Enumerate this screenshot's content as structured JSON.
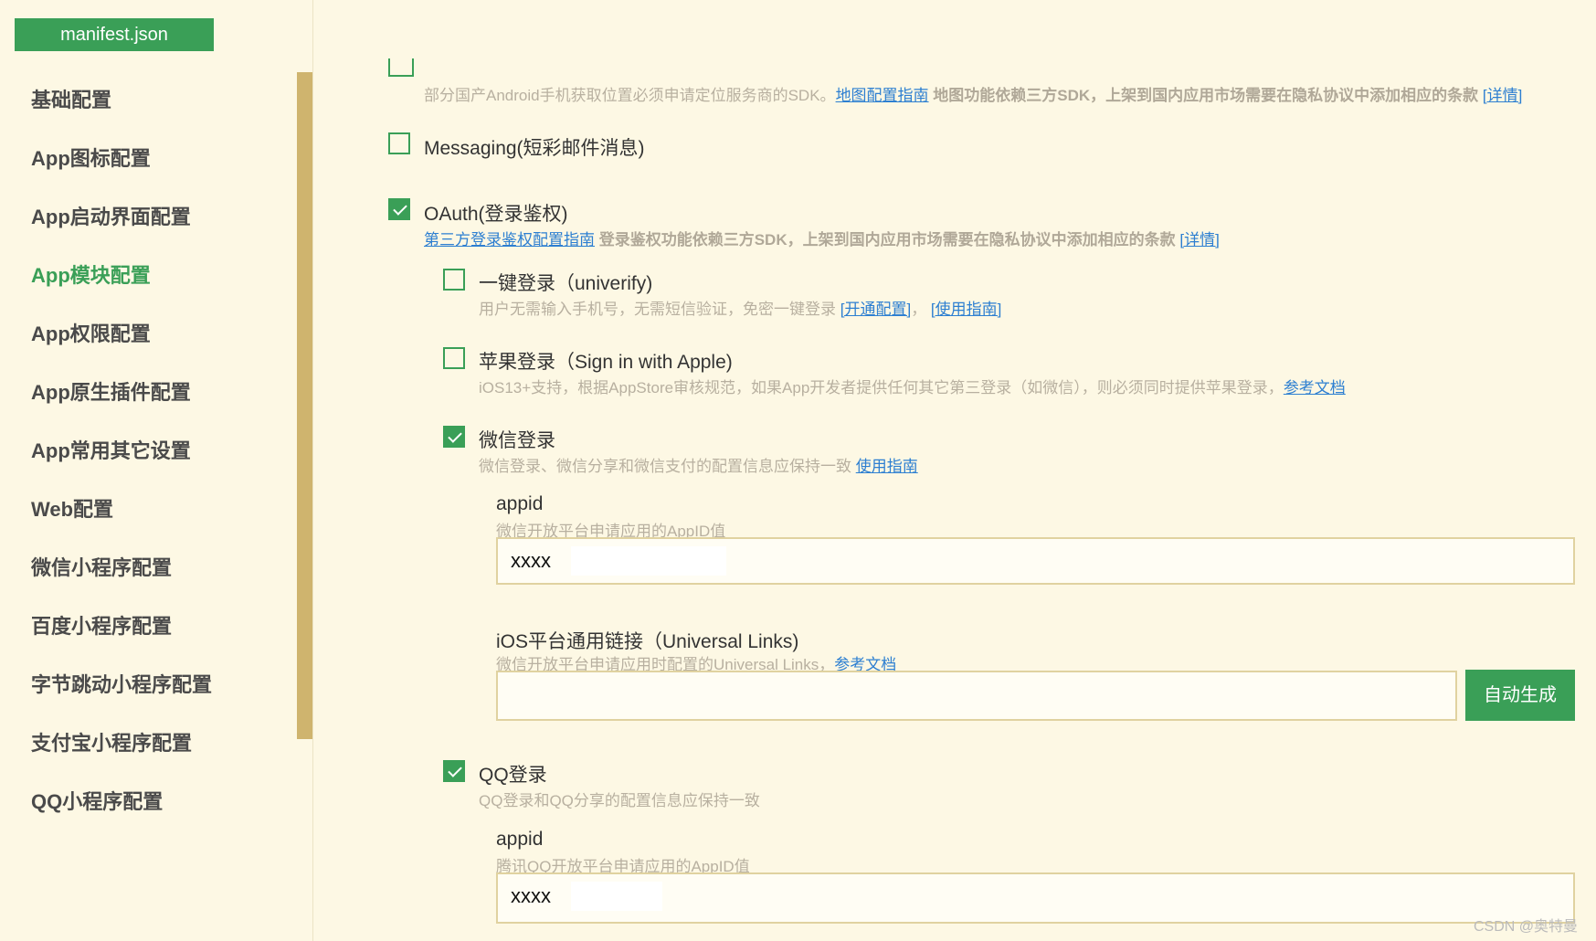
{
  "tab": {
    "label": "manifest.json"
  },
  "sidebar": {
    "items": [
      {
        "label": "基础配置",
        "active": false
      },
      {
        "label": "App图标配置",
        "active": false
      },
      {
        "label": "App启动界面配置",
        "active": false
      },
      {
        "label": "App模块配置",
        "active": true
      },
      {
        "label": "App权限配置",
        "active": false
      },
      {
        "label": "App原生插件配置",
        "active": false
      },
      {
        "label": "App常用其它设置",
        "active": false
      },
      {
        "label": "Web配置",
        "active": false
      },
      {
        "label": "微信小程序配置",
        "active": false
      },
      {
        "label": "百度小程序配置",
        "active": false
      },
      {
        "label": "字节跳动小程序配置",
        "active": false
      },
      {
        "label": "支付宝小程序配置",
        "active": false
      },
      {
        "label": "QQ小程序配置",
        "active": false
      }
    ]
  },
  "maps": {
    "desc": "部分国产Android手机获取位置必须申请定位服务商的SDK。",
    "link_guide": "地图配置指南",
    "bold_note": " 地图功能依赖三方SDK，上架到国内应用市场需要在隐私协议中添加相应的条款 ",
    "link_detail": "[详情]"
  },
  "messaging": {
    "label": "Messaging(短彩邮件消息)",
    "checked": false
  },
  "oauth": {
    "label": "OAuth(登录鉴权)",
    "checked": true,
    "link_guide": "第三方登录鉴权配置指南",
    "bold_note": " 登录鉴权功能依赖三方SDK，上架到国内应用市场需要在隐私协议中添加相应的条款 ",
    "link_detail": "[详情]"
  },
  "univerify": {
    "label": "一键登录（univerify)",
    "checked": false,
    "desc": "用户无需输入手机号，无需短信验证，免密一键登录 ",
    "link_open": "[开通配置]",
    "sep": "，",
    "link_guide": "[使用指南]"
  },
  "apple": {
    "label": "苹果登录（Sign in with Apple)",
    "checked": false,
    "desc": "iOS13+支持，根据AppStore审核规范，如果App开发者提供任何其它第三登录（如微信），则必须同时提供苹果登录，",
    "link_doc": "参考文档"
  },
  "weixin": {
    "label": "微信登录",
    "checked": true,
    "desc": "微信登录、微信分享和微信支付的配置信息应保持一致 ",
    "link_guide": "使用指南",
    "appid": {
      "label": "appid",
      "hint": "微信开放平台申请应用的AppID值",
      "value": "xxxx"
    },
    "ulink": {
      "label": "iOS平台通用链接（Universal Links)",
      "hint": "微信开放平台申请应用时配置的Universal Links，",
      "link_doc": "参考文档",
      "value": "",
      "button": "自动生成"
    }
  },
  "qq": {
    "label": "QQ登录",
    "checked": true,
    "desc": "QQ登录和QQ分享的配置信息应保持一致",
    "appid": {
      "label": "appid",
      "hint": "腾讯QQ开放平台申请应用的AppID值",
      "value": "xxxx"
    }
  },
  "watermark": "CSDN @奥特曼"
}
